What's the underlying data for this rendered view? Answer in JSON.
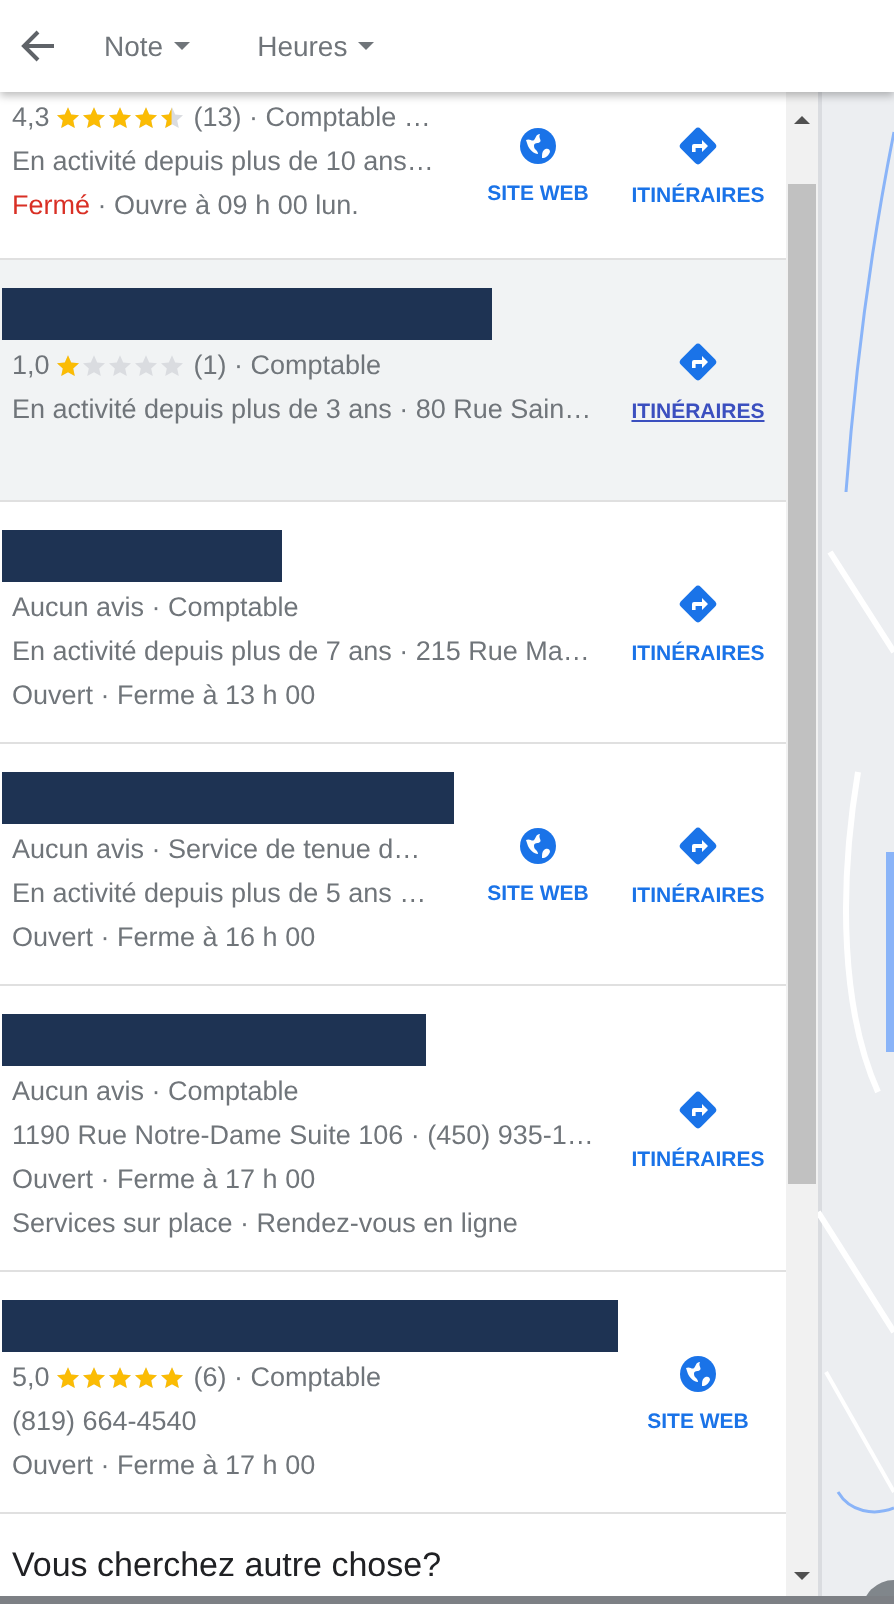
{
  "toolbar": {
    "filters": [
      {
        "label": "Note"
      },
      {
        "label": "Heures"
      }
    ]
  },
  "listings": [
    {
      "highlighted": false,
      "lines": [
        {
          "kind": "rating",
          "rating": "4,3",
          "stars": 4.5,
          "info": "(13) · Comptable …"
        },
        {
          "kind": "text",
          "text": "En activité depuis plus de 10 ans…"
        },
        {
          "kind": "hours",
          "status": "Fermé",
          "open": false,
          "detail": "· Ouvre à 09 h 00 lun."
        }
      ],
      "actions": [
        {
          "kind": "website",
          "label": "SITE WEB",
          "hovered": false
        },
        {
          "kind": "directions",
          "label": "ITINÉRAIRES",
          "hovered": false
        }
      ]
    },
    {
      "redacted": true,
      "highlighted": true,
      "lines": [
        {
          "kind": "rating",
          "rating": "1,0",
          "stars": 1,
          "info": "(1) · Comptable"
        },
        {
          "kind": "text",
          "text": "En activité depuis plus de 3 ans · 80 Rue Sain…"
        }
      ],
      "actions": [
        {
          "kind": "directions",
          "label": "ITINÉRAIRES",
          "hovered": true
        }
      ]
    },
    {
      "redacted": true,
      "highlighted": false,
      "lines": [
        {
          "kind": "text",
          "text": "Aucun avis · Comptable"
        },
        {
          "kind": "text",
          "text": "En activité depuis plus de 7 ans · 215 Rue Ma…"
        },
        {
          "kind": "hours",
          "status": "Ouvert",
          "open": true,
          "detail": "· Ferme à 13 h 00"
        }
      ],
      "actions": [
        {
          "kind": "directions",
          "label": "ITINÉRAIRES",
          "hovered": false
        }
      ]
    },
    {
      "redacted": true,
      "highlighted": false,
      "lines": [
        {
          "kind": "text",
          "text": "Aucun avis · Service de tenue d…"
        },
        {
          "kind": "text",
          "text": "En activité depuis plus de 5 ans …"
        },
        {
          "kind": "hours",
          "status": "Ouvert",
          "open": true,
          "detail": "· Ferme à 16 h 00"
        }
      ],
      "actions": [
        {
          "kind": "website",
          "label": "SITE WEB",
          "hovered": false
        },
        {
          "kind": "directions",
          "label": "ITINÉRAIRES",
          "hovered": false
        }
      ]
    },
    {
      "redacted": true,
      "highlighted": false,
      "lines": [
        {
          "kind": "text",
          "text": "Aucun avis · Comptable"
        },
        {
          "kind": "text",
          "text": "1190 Rue Notre-Dame Suite 106 · (450) 935-1…"
        },
        {
          "kind": "hours",
          "status": "Ouvert",
          "open": true,
          "detail": "· Ferme à 17 h 00"
        },
        {
          "kind": "text",
          "text": "Services sur place · Rendez-vous en ligne"
        }
      ],
      "actions": [
        {
          "kind": "directions",
          "label": "ITINÉRAIRES",
          "hovered": false
        }
      ]
    },
    {
      "redacted": true,
      "highlighted": false,
      "lines": [
        {
          "kind": "rating",
          "rating": "5,0",
          "stars": 5,
          "info": "(6) · Comptable"
        },
        {
          "kind": "text",
          "text": "(819) 664-4540"
        },
        {
          "kind": "hours",
          "status": "Ouvert",
          "open": true,
          "detail": "· Ferme à 17 h 00"
        }
      ],
      "actions": [
        {
          "kind": "website",
          "label": "SITE WEB",
          "hovered": false
        }
      ]
    }
  ],
  "footer": {
    "prompt": "Vous cherchez autre chose?"
  }
}
